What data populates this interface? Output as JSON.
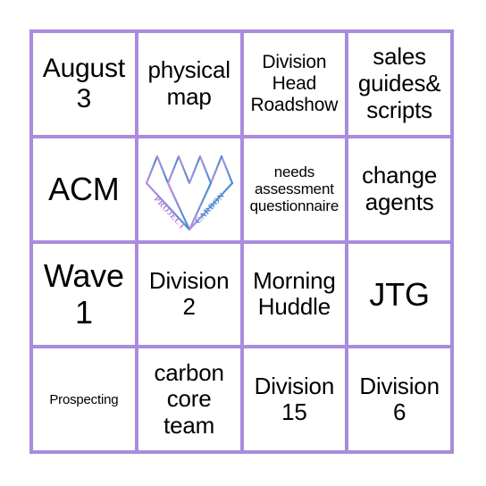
{
  "card": {
    "type": "bingo-card",
    "columns": 4,
    "rows": 4,
    "border_color": "#a98cdd",
    "background_color": "#ffffff",
    "text_color": "#000000",
    "cells": [
      {
        "id": "r1c1",
        "text": "August 3",
        "size": "xl"
      },
      {
        "id": "r1c2",
        "text": "physical map",
        "size": "lg"
      },
      {
        "id": "r1c3",
        "text": "Division Head Roadshow",
        "size": "md"
      },
      {
        "id": "r1c4",
        "text": "sales guides& scripts",
        "size": "lg"
      },
      {
        "id": "r2c1",
        "text": "ACM",
        "size": "xxl"
      },
      {
        "id": "r2c2",
        "text": "",
        "size": "md",
        "kind": "logo"
      },
      {
        "id": "r2c3",
        "text": "needs assessment questionnaire",
        "size": "sm"
      },
      {
        "id": "r2c4",
        "text": "change agents",
        "size": "lg"
      },
      {
        "id": "r3c1",
        "text": "Wave 1",
        "size": "xxl"
      },
      {
        "id": "r3c2",
        "text": "Division 2",
        "size": "lg"
      },
      {
        "id": "r3c3",
        "text": "Morning Huddle",
        "size": "lg"
      },
      {
        "id": "r3c4",
        "text": "JTG",
        "size": "xxl"
      },
      {
        "id": "r4c1",
        "text": "Prospecting",
        "size": "xs"
      },
      {
        "id": "r4c2",
        "text": "carbon core team",
        "size": "lg"
      },
      {
        "id": "r4c3",
        "text": "Division 15",
        "size": "lg"
      },
      {
        "id": "r4c4",
        "text": "Division 6",
        "size": "lg"
      }
    ]
  },
  "logo": {
    "name": "project-carbon-diamond-logo",
    "shape": "diamond",
    "left_word": "PROJECT",
    "right_word": "CARBON",
    "left_color": "#b47fd6",
    "right_color": "#4a90cf",
    "gradient_from": "#c08ade",
    "gradient_to": "#3f8fd0"
  }
}
